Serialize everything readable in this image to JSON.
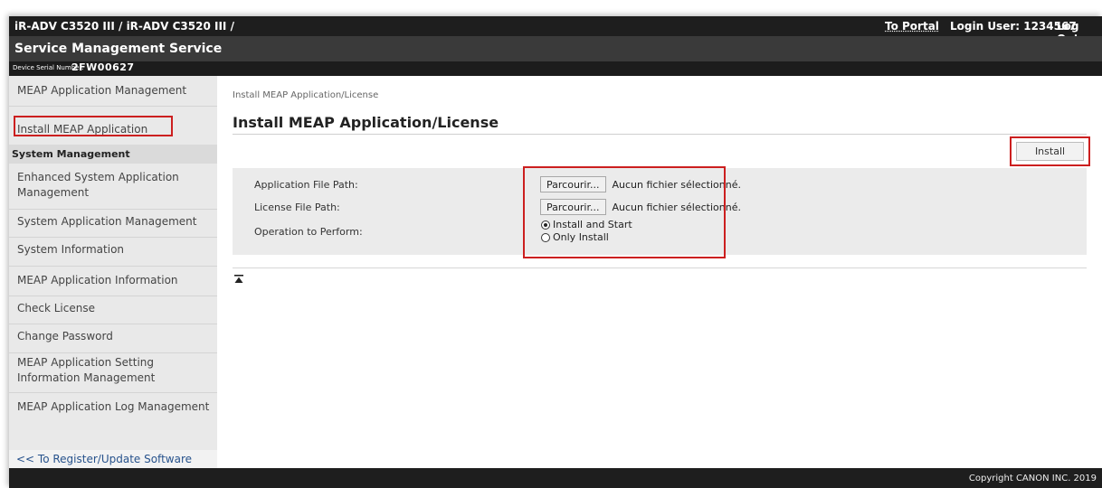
{
  "header": {
    "model": "iR-ADV C3520 III / iR-ADV C3520 III /",
    "to_portal": "To Portal",
    "login_user": "Login User: 1234567",
    "logout": "Log Out",
    "app_title": "Service Management Service",
    "serial_label": "Device Serial Number:",
    "serial_value": "2FW00627"
  },
  "sidebar": {
    "items": [
      {
        "label": "MEAP Application Management"
      },
      {
        "label": "Install MEAP Application"
      }
    ],
    "section_title": "System Management",
    "section_items": [
      {
        "label": "Enhanced System Application Management"
      },
      {
        "label": "System Application Management"
      },
      {
        "label": "System Information"
      },
      {
        "label": "MEAP Application Information"
      },
      {
        "label": "Check License"
      },
      {
        "label": "Change Password"
      },
      {
        "label": "MEAP Application Setting Information Management"
      },
      {
        "label": "MEAP Application Log Management"
      }
    ],
    "register_link": "<< To Register/Update Software"
  },
  "main": {
    "breadcrumb": "Install MEAP Application/License",
    "title": "Install MEAP Application/License",
    "install_button": "Install",
    "form": {
      "app_file_label": "Application File Path:",
      "license_file_label": "License File Path:",
      "operation_label": "Operation to Perform:",
      "browse_label": "Parcourir...",
      "no_file_text": "Aucun fichier sélectionné.",
      "options": [
        {
          "label": "Install and Start",
          "checked": true
        },
        {
          "label": "Only Install",
          "checked": false
        }
      ]
    }
  },
  "footer": {
    "copyright": "Copyright CANON INC. 2019"
  },
  "colors": {
    "highlight": "#cc1f1f",
    "header_bg": "#1e1e1e",
    "sidebar_bg": "#e9e9e9",
    "link": "#27528c"
  },
  "icons": {
    "back_to_top": "back-to-top-icon"
  }
}
